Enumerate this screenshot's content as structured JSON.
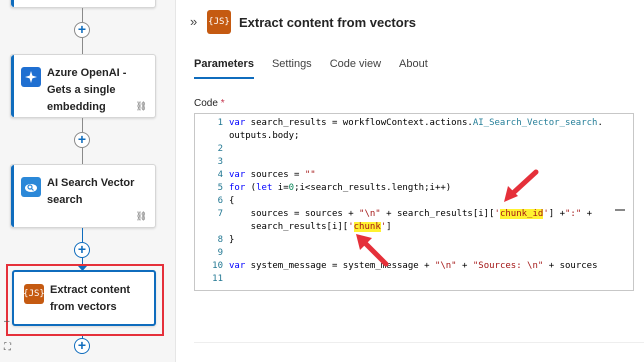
{
  "canvas": {
    "nodes": [
      {
        "title": "Azure OpenAI - Gets a single embedding",
        "icon": "openai-icon",
        "icon_color": "#1f6fd1"
      },
      {
        "title": "AI Search Vector search",
        "icon": "search-cloud-icon",
        "icon_color": "#2b88d8"
      },
      {
        "title": "Extract content from vectors",
        "icon": "js-icon",
        "icon_text": "{JS}",
        "icon_color": "#c55a11"
      }
    ],
    "plus_glyph": "+",
    "link_glyph": "⛓",
    "bottom_ctrls": [
      "–",
      "⛶"
    ]
  },
  "panel": {
    "collapse_glyph": "»",
    "icon_text": "{JS}",
    "title": "Extract content from vectors",
    "tabs": [
      {
        "label": "Parameters",
        "active": true
      },
      {
        "label": "Settings",
        "active": false
      },
      {
        "label": "Code view",
        "active": false
      },
      {
        "label": "About",
        "active": false
      }
    ],
    "code_label": "Code",
    "required_mark": "*"
  },
  "code": {
    "line_numbers": [
      "1",
      "",
      "2",
      "3",
      "4",
      "5",
      "6",
      "7",
      "",
      "8",
      "9",
      "10",
      "11"
    ],
    "l1a": "var",
    "l1b": " search_results = workflowContext.actions.",
    "l1c": "AI_Search_Vector_search",
    "l1d": ".",
    "l1e": "outputs.body;",
    "l4a": "var",
    "l4b": " sources = ",
    "l4c": "\"\"",
    "l5a": "for",
    "l5b": " (",
    "l5c": "let",
    "l5d": " i=",
    "l5e": "0",
    "l5f": ";i<search_results.length;i++)",
    "l6": "{",
    "l7a": "    sources = sources + ",
    "l7b": "\"\\n\"",
    "l7c": " + search_results[i][",
    "l7d": "'",
    "l7e": "chunk_id",
    "l7f": "'",
    "l7g": "] +",
    "l7h": "\":\"",
    "l7i": " +",
    "l7j": "    search_results[i][",
    "l7k": "'",
    "l7l": "chunk",
    "l7m": "'",
    "l7n": "]",
    "l8": "}",
    "l10a": "var",
    "l10b": " system_message = system_message + ",
    "l10c": "\"\\n\"",
    "l10d": " + ",
    "l10e": "\"Sources: \\n\"",
    "l10f": " + sources"
  },
  "colors": {
    "accent": "#0f6cbd",
    "annotation_red": "#e5303a",
    "highlight": "#fff230"
  }
}
